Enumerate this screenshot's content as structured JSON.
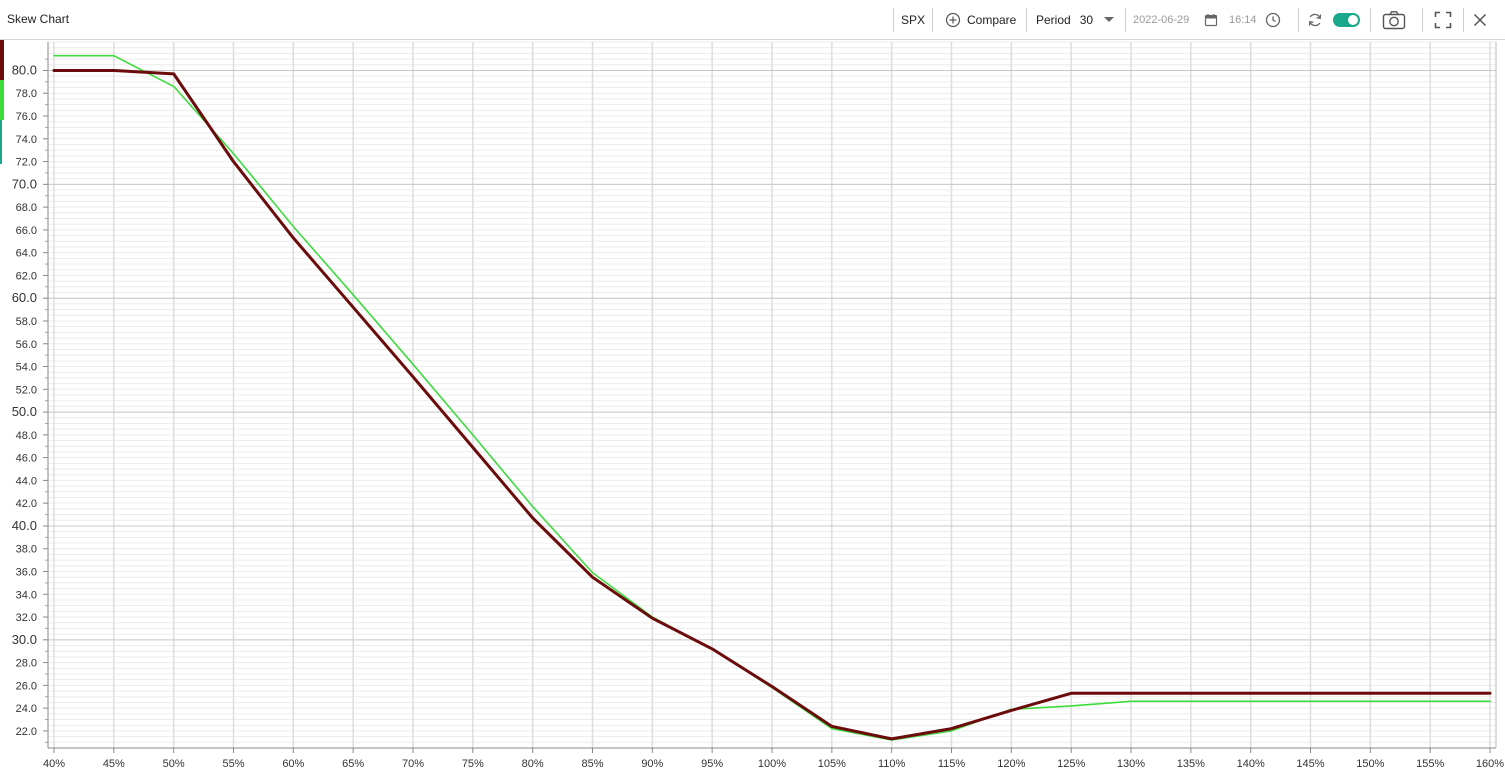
{
  "window": {
    "title": "Skew Chart"
  },
  "toolbar": {
    "symbol": "SPX",
    "compare_label": "Compare",
    "period_label": "Period",
    "period_value": "30",
    "date": "2022-06-29",
    "time": "16:14",
    "icons": {
      "compare": "plus-circle-icon",
      "period_dropdown": "chevron-down-icon",
      "date": "calendar-icon",
      "time": "clock-icon",
      "refresh": "refresh-icon",
      "toggle": "toggle-switch",
      "screenshot": "camera-icon",
      "fullscreen": "expand-icon",
      "close": "close-icon"
    },
    "toggle_on": true
  },
  "colors": {
    "series_dark": "#6b0b0b",
    "series_green": "#3ddc3d",
    "accent": "#1aa88a",
    "grid_major": "#c8c8c8",
    "grid_minor": "#ececec"
  },
  "chart_data": {
    "type": "line",
    "title": "",
    "xlabel": "",
    "ylabel": "",
    "x": [
      "40%",
      "45%",
      "50%",
      "55%",
      "60%",
      "65%",
      "70%",
      "75%",
      "80%",
      "85%",
      "90%",
      "95%",
      "100%",
      "105%",
      "110%",
      "115%",
      "120%",
      "125%",
      "130%",
      "135%",
      "140%",
      "145%",
      "150%",
      "155%",
      "160%"
    ],
    "series": [
      {
        "color": "#3ddc3d",
        "values": [
          81.3,
          81.3,
          78.6,
          72.7,
          66.3,
          60.3,
          54.2,
          48.0,
          41.7,
          35.9,
          32.0,
          29.2,
          25.8,
          22.2,
          21.2,
          22.0,
          23.9,
          24.2,
          24.6,
          24.6,
          24.6,
          24.6,
          24.6,
          24.6,
          24.6
        ]
      },
      {
        "color": "#6b0b0b",
        "values": [
          80.0,
          80.0,
          79.7,
          72.0,
          65.3,
          59.2,
          53.1,
          46.9,
          40.7,
          35.5,
          31.9,
          29.2,
          25.9,
          22.4,
          21.3,
          22.2,
          23.8,
          25.3,
          25.3,
          25.3,
          25.3,
          25.3,
          25.3,
          25.3,
          25.3
        ]
      }
    ],
    "y_ticks": [
      "80.0",
      "78.0",
      "76.0",
      "74.0",
      "72.0",
      "70.0",
      "68.0",
      "66.0",
      "64.0",
      "62.0",
      "60.0",
      "58.0",
      "56.0",
      "54.0",
      "52.0",
      "50.0",
      "48.0",
      "46.0",
      "44.0",
      "42.0",
      "40.0",
      "38.0",
      "36.0",
      "34.0",
      "32.0",
      "30.0",
      "28.0",
      "26.0",
      "24.0",
      "22.0"
    ],
    "ylim": [
      20.5,
      82.5
    ],
    "y_major_step": 10,
    "grid": true,
    "legend": "none"
  }
}
